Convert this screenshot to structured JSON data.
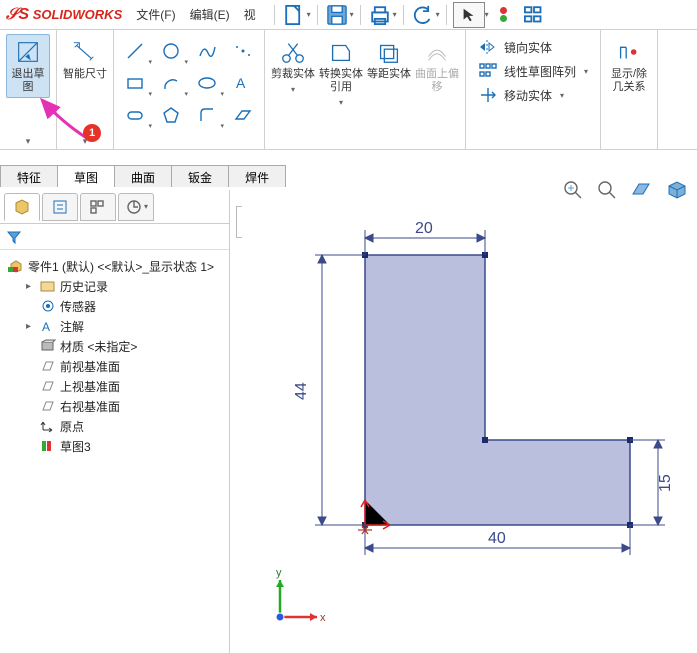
{
  "app": {
    "brand": "SOLIDWORKS"
  },
  "menu": {
    "file": "文件(F)",
    "edit": "编辑(E)",
    "view_short": "视"
  },
  "ribbon": {
    "exit_sketch": "退出草图",
    "smart_dim": "智能尺寸",
    "trim": "剪裁实体",
    "convert": "转换实体引用",
    "offset": "等距实体",
    "surface_curve": "曲面上偏移",
    "mirror": "镜向实体",
    "linear_pattern": "线性草图阵列",
    "move": "移动实体",
    "display": "显示/除几关系"
  },
  "tabs": {
    "feature": "特征",
    "sketch": "草图",
    "surface": "曲面",
    "sheetmetal": "钣金",
    "weldment": "焊件"
  },
  "tree": {
    "root": "零件1 (默认) <<默认>_显示状态 1>",
    "history": "历史记录",
    "sensors": "传感器",
    "annotations": "注解",
    "material": "材质 <未指定>",
    "front_plane": "前视基准面",
    "top_plane": "上视基准面",
    "right_plane": "右视基准面",
    "origin": "原点",
    "sketch3": "草图3"
  },
  "annotation": {
    "badge1": "1"
  },
  "sketch_dims": {
    "top": "20",
    "left": "44",
    "bottom": "40",
    "right": "15"
  },
  "axes": {
    "x": "x",
    "y": "y"
  }
}
